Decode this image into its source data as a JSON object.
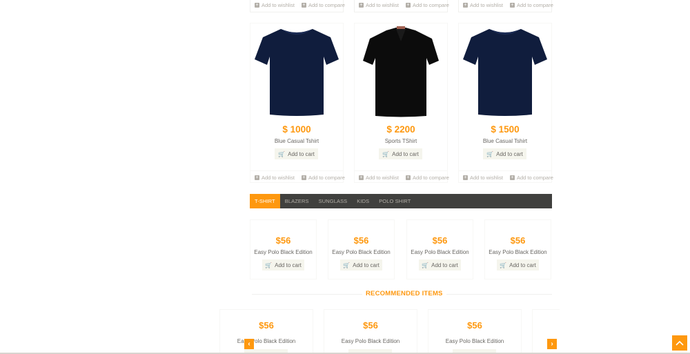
{
  "colors": {
    "accent": "#fe980f",
    "tab_bar": "#40403e",
    "text": "#696763",
    "muted": "#b3afa8"
  },
  "top_row": [
    {
      "wishlist": "Add to wishlist",
      "compare": "Add to compare"
    },
    {
      "wishlist": "Add to wishlist",
      "compare": "Add to compare"
    },
    {
      "wishlist": "Add to wishlist",
      "compare": "Add to compare"
    }
  ],
  "products": [
    {
      "price": "$ 1000",
      "name": "Blue Casual Tshirt",
      "cart": "Add to cart",
      "wishlist": "Add to wishlist",
      "compare": "Add to compare",
      "image": "navy-tshirt"
    },
    {
      "price": "$ 2200",
      "name": "Sports TShirt",
      "cart": "Add to cart",
      "wishlist": "Add to wishlist",
      "compare": "Add to compare",
      "image": "black-polo"
    },
    {
      "price": "$ 1500",
      "name": "Blue Casual Tshirt",
      "cart": "Add to cart",
      "wishlist": "Add to wishlist",
      "compare": "Add to compare",
      "image": "navy-tshirt"
    }
  ],
  "tabs": [
    {
      "label": "T-SHIRT",
      "active": true
    },
    {
      "label": "BLAZERS"
    },
    {
      "label": "SUNGLASS"
    },
    {
      "label": "KIDS"
    },
    {
      "label": "POLO SHIRT"
    }
  ],
  "tab_items": [
    {
      "price": "$56",
      "name": "Easy Polo Black Edition",
      "cart": "Add to cart"
    },
    {
      "price": "$56",
      "name": "Easy Polo Black Edition",
      "cart": "Add to cart"
    },
    {
      "price": "$56",
      "name": "Easy Polo Black Edition",
      "cart": "Add to cart"
    },
    {
      "price": "$56",
      "name": "Easy Polo Black Edition",
      "cart": "Add to cart"
    }
  ],
  "recommended": {
    "title": "RECOMMENDED ITEMS",
    "items": [
      {
        "price": "$56",
        "name": "Easy Polo Black Edition"
      },
      {
        "price": "$56",
        "name": "Easy Polo Black Edition"
      },
      {
        "price": "$56",
        "name": "Easy Polo Black Edition"
      }
    ],
    "prev_icon": "chevron-left-icon",
    "next_icon": "chevron-right-icon"
  },
  "scroll_up_icon": "chevron-up-icon"
}
